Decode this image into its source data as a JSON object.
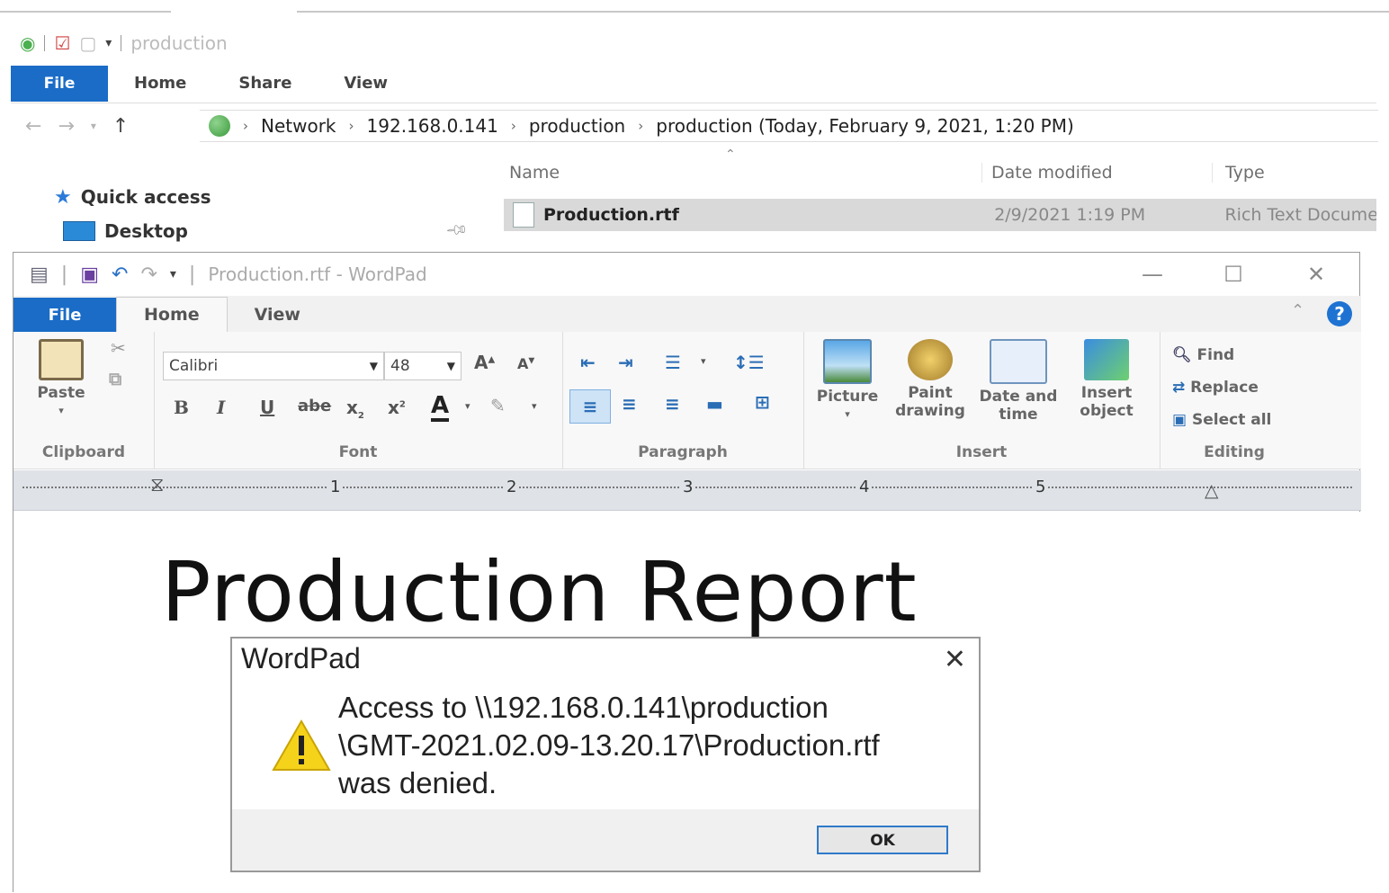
{
  "explorer": {
    "qat_title": "production",
    "tabs": [
      "File",
      "Home",
      "Share",
      "View"
    ],
    "breadcrumb": [
      "Network",
      "192.168.0.141",
      "production",
      "production (Today, February 9, 2021, 1:20 PM)"
    ],
    "nav": {
      "quick_access": "Quick access",
      "desktop": "Desktop"
    },
    "columns": {
      "name": "Name",
      "date": "Date modified",
      "type": "Type"
    },
    "file": {
      "name": "Production.rtf",
      "date": "2/9/2021 1:19 PM",
      "type": "Rich Text Docume"
    }
  },
  "wordpad": {
    "title": "Production.rtf - WordPad",
    "tabs": [
      "File",
      "Home",
      "View"
    ],
    "clipboard": {
      "paste": "Paste",
      "label": "Clipboard"
    },
    "font": {
      "family": "Calibri",
      "size": "48",
      "label": "Font"
    },
    "paragraph": {
      "label": "Paragraph"
    },
    "insert": {
      "picture": "Picture",
      "paint1": "Paint",
      "paint2": "drawing",
      "date1": "Date and",
      "date2": "time",
      "object1": "Insert",
      "object2": "object",
      "label": "Insert"
    },
    "editing": {
      "find": "Find",
      "replace": "Replace",
      "select_all": "Select all",
      "label": "Editing"
    },
    "ruler": [
      "1",
      "2",
      "3",
      "4",
      "5"
    ],
    "document_text": "Production Report"
  },
  "dialog": {
    "title": "WordPad",
    "message": "Access to \\\\192.168.0.141\\production\n\\GMT-2021.02.09-13.20.17\\Production.rtf\nwas denied.",
    "ok": "OK"
  },
  "colors": {
    "accent": "#1a6cc7",
    "warning": "#f5d31b"
  }
}
